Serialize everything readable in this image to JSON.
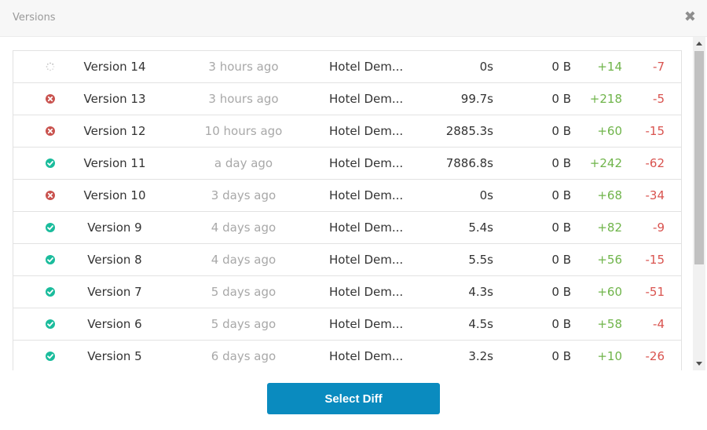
{
  "modal": {
    "title": "Versions",
    "close_glyph": "✖"
  },
  "colors": {
    "success": "#1abc9c",
    "error": "#c9534f",
    "pending": "#b0b0b0",
    "additions": "#6fb44a",
    "deletions": "#d9534f",
    "button": "#0a8bbf"
  },
  "versions": [
    {
      "status": "pending",
      "icon": "spinner-icon",
      "name": "Version 14",
      "time": "3 hours ago",
      "env": "Hotel Dem...",
      "duration": "0s",
      "size": "0 B",
      "added": "+14",
      "removed": "-7"
    },
    {
      "status": "error",
      "icon": "error-icon",
      "name": "Version 13",
      "time": "3 hours ago",
      "env": "Hotel Dem...",
      "duration": "99.7s",
      "size": "0 B",
      "added": "+218",
      "removed": "-5"
    },
    {
      "status": "error",
      "icon": "error-icon",
      "name": "Version 12",
      "time": "10 hours ago",
      "env": "Hotel Dem...",
      "duration": "2885.3s",
      "size": "0 B",
      "added": "+60",
      "removed": "-15"
    },
    {
      "status": "success",
      "icon": "check-icon",
      "name": "Version 11",
      "time": "a day ago",
      "env": "Hotel Dem...",
      "duration": "7886.8s",
      "size": "0 B",
      "added": "+242",
      "removed": "-62"
    },
    {
      "status": "error",
      "icon": "error-icon",
      "name": "Version 10",
      "time": "3 days ago",
      "env": "Hotel Dem...",
      "duration": "0s",
      "size": "0 B",
      "added": "+68",
      "removed": "-34"
    },
    {
      "status": "success",
      "icon": "check-icon",
      "name": "Version 9",
      "time": "4 days ago",
      "env": "Hotel Dem...",
      "duration": "5.4s",
      "size": "0 B",
      "added": "+82",
      "removed": "-9"
    },
    {
      "status": "success",
      "icon": "check-icon",
      "name": "Version 8",
      "time": "4 days ago",
      "env": "Hotel Dem...",
      "duration": "5.5s",
      "size": "0 B",
      "added": "+56",
      "removed": "-15"
    },
    {
      "status": "success",
      "icon": "check-icon",
      "name": "Version 7",
      "time": "5 days ago",
      "env": "Hotel Dem...",
      "duration": "4.3s",
      "size": "0 B",
      "added": "+60",
      "removed": "-51"
    },
    {
      "status": "success",
      "icon": "check-icon",
      "name": "Version 6",
      "time": "5 days ago",
      "env": "Hotel Dem...",
      "duration": "4.5s",
      "size": "0 B",
      "added": "+58",
      "removed": "-4"
    },
    {
      "status": "success",
      "icon": "check-icon",
      "name": "Version 5",
      "time": "6 days ago",
      "env": "Hotel Dem...",
      "duration": "3.2s",
      "size": "0 B",
      "added": "+10",
      "removed": "-26"
    }
  ],
  "footer": {
    "select_diff_label": "Select Diff"
  }
}
